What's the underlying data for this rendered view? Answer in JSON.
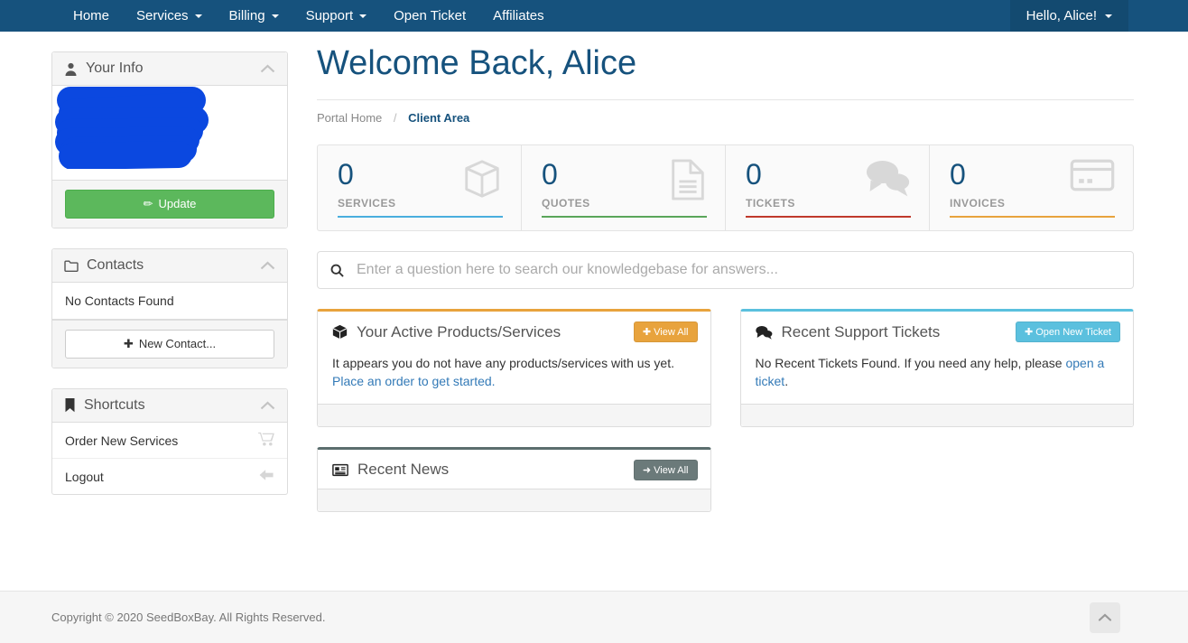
{
  "navbar": {
    "items": [
      {
        "label": "Home",
        "caret": false
      },
      {
        "label": "Services",
        "caret": true
      },
      {
        "label": "Billing",
        "caret": true
      },
      {
        "label": "Support",
        "caret": true
      },
      {
        "label": "Open Ticket",
        "caret": false
      },
      {
        "label": "Affiliates",
        "caret": false
      }
    ],
    "user_greeting": "Hello, Alice!",
    "bg_color": "#16527d",
    "user_bg_color": "#134a70"
  },
  "sidebar": {
    "your_info": {
      "title": "Your Info",
      "icon": "user-icon",
      "redacted": true,
      "update_button": "Update",
      "update_icon": "pencil-icon",
      "update_color": "#5cb85c"
    },
    "contacts": {
      "title": "Contacts",
      "icon": "folder-icon",
      "empty_text": "No Contacts Found",
      "new_contact_button": "New Contact...",
      "new_contact_icon": "plus-icon"
    },
    "shortcuts": {
      "title": "Shortcuts",
      "icon": "bookmark-icon",
      "items": [
        {
          "label": "Order New Services",
          "icon": "shopping-cart-icon"
        },
        {
          "label": "Logout",
          "icon": "arrow-left-icon"
        }
      ]
    }
  },
  "main": {
    "page_title": "Welcome Back, Alice",
    "breadcrumb": {
      "home": "Portal Home",
      "separator": "/",
      "current": "Client Area"
    },
    "stats": [
      {
        "value": "0",
        "label": "SERVICES",
        "color": "#4aaede",
        "icon": "box-icon"
      },
      {
        "value": "0",
        "label": "QUOTES",
        "color": "#5aa65a",
        "icon": "document-icon"
      },
      {
        "value": "0",
        "label": "TICKETS",
        "color": "#c0392b",
        "icon": "comments-icon"
      },
      {
        "value": "0",
        "label": "INVOICES",
        "color": "#e8a33d",
        "icon": "credit-card-icon"
      }
    ],
    "search": {
      "placeholder": "Enter a question here to search our knowledgebase for answers...",
      "value": "",
      "icon": "search-icon"
    },
    "cards": {
      "products": {
        "title": "Your Active Products/Services",
        "icon": "box-icon",
        "button_label": "View All",
        "button_icon": "plus-icon",
        "accent_color": "#e8a33d",
        "body_text": "It appears you do not have any products/services with us yet.",
        "body_link": "Place an order to get started."
      },
      "tickets": {
        "title": "Recent Support Tickets",
        "icon": "comments-icon",
        "button_label": "Open New Ticket",
        "button_icon": "plus-icon",
        "accent_color": "#5bc0de",
        "body_text": "No Recent Tickets Found. If you need any help, please ",
        "body_link": "open a ticket",
        "body_text_end": "."
      },
      "news": {
        "title": "Recent News",
        "icon": "newspaper-icon",
        "button_label": "View All",
        "button_icon": "arrow-right-icon",
        "accent_color": "#5b6e6e",
        "button_color": "#6b7a7a"
      }
    }
  },
  "footer": {
    "copyright": "Copyright © 2020 SeedBoxBay. All Rights Reserved.",
    "to_top_icon": "chevron-up-icon"
  }
}
